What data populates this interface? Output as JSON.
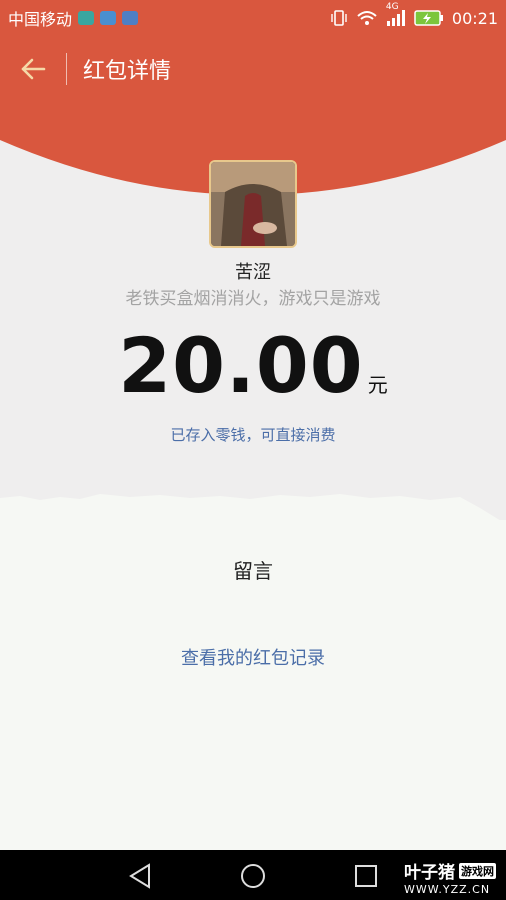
{
  "status_bar": {
    "carrier": "中国移动",
    "network": "4G",
    "time": "00:21"
  },
  "header": {
    "title": "红包详情",
    "back_icon": "back-arrow-icon"
  },
  "sender": {
    "name": "苦涩",
    "wish": "老铁买盒烟消消火，游戏只是游戏"
  },
  "amount": {
    "value": "20.00",
    "unit": "元",
    "note": "已存入零钱，可直接消费"
  },
  "actions": {
    "leave_message": "留言",
    "view_records": "查看我的红包记录"
  },
  "watermark": {
    "brand": "叶子猪",
    "tag": "游戏网",
    "url": "WWW.YZZ.CN"
  },
  "colors": {
    "brand_red": "#d9573e",
    "link_blue": "#4b6ea8"
  }
}
